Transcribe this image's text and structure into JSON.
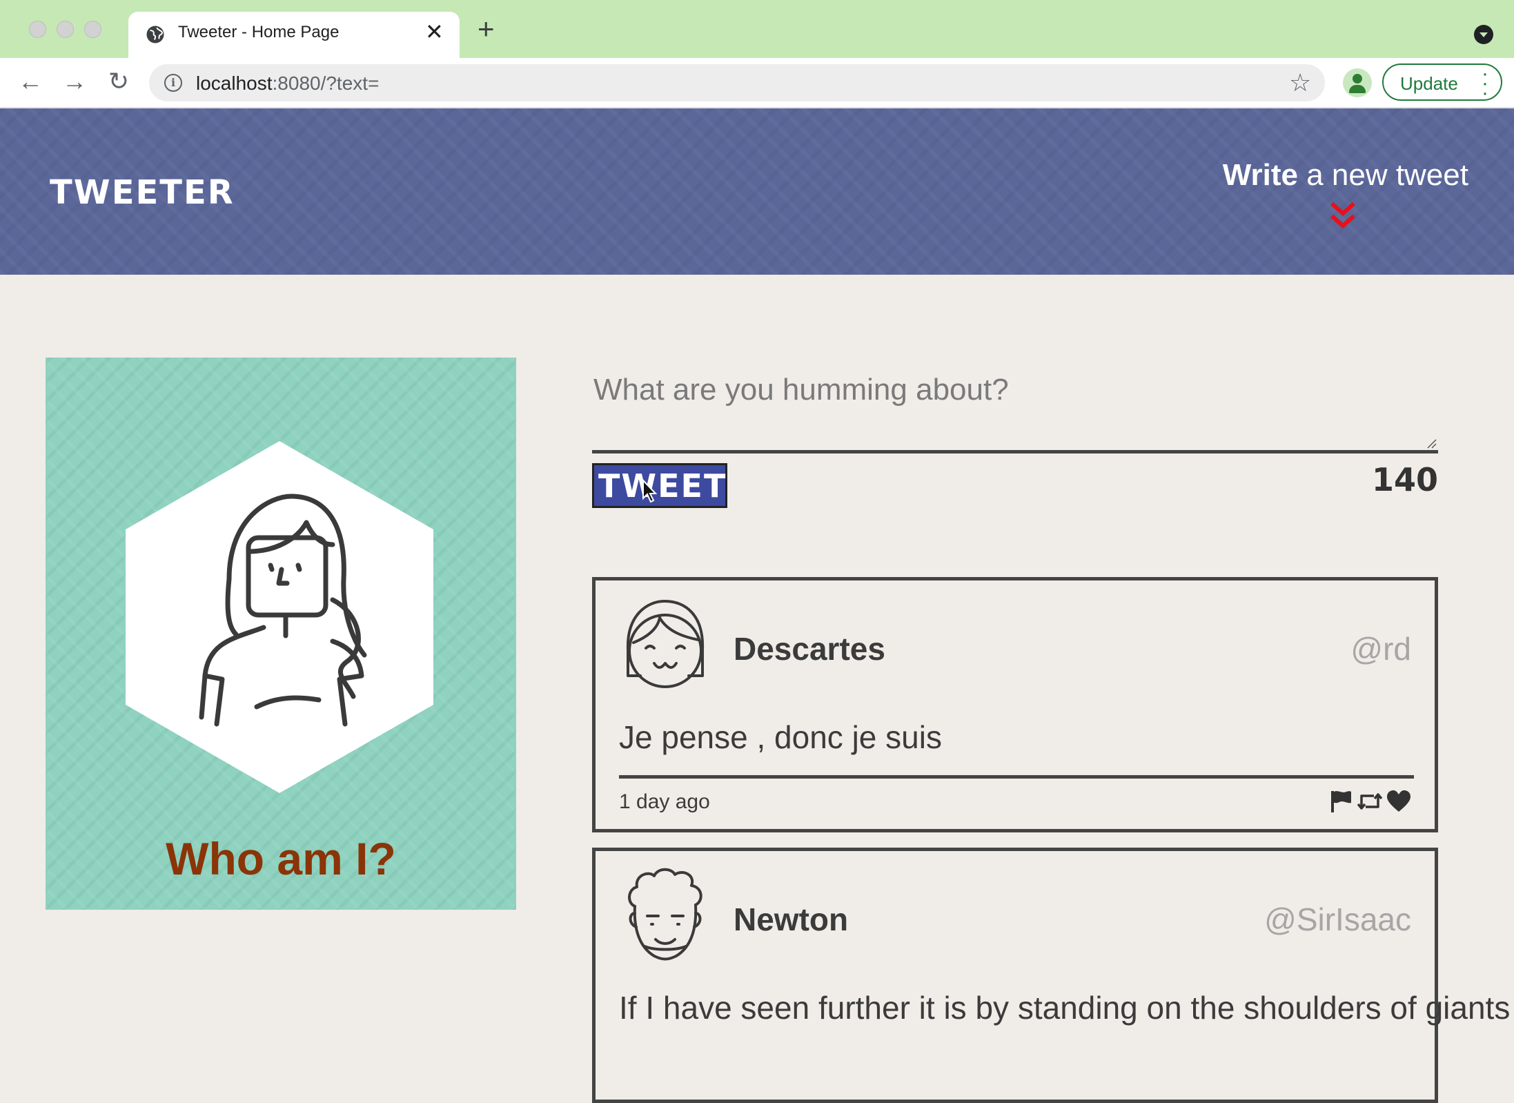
{
  "browser": {
    "tab_title": "Tweeter - Home Page",
    "url_host": "localhost",
    "url_rest": ":8080/?text=",
    "update_label": "Update"
  },
  "header": {
    "brand": "TWEETER",
    "compose_strong": "Write",
    "compose_rest": " a new tweet"
  },
  "profile": {
    "caption": "Who am I?"
  },
  "composer": {
    "placeholder": "What are you humming about?",
    "button_label": "TWEET",
    "char_count": "140"
  },
  "tweets": [
    {
      "name": "Descartes",
      "handle": "@rd",
      "text": "Je pense , donc je suis",
      "time": "1 day ago"
    },
    {
      "name": "Newton",
      "handle": "@SirIsaac",
      "text": "If I have seen further it is by standing on the shoulders of giants"
    }
  ],
  "icons": [
    "globe-icon",
    "close-icon",
    "plus-icon",
    "back-arrow-icon",
    "forward-arrow-icon",
    "reload-icon",
    "info-icon",
    "star-icon",
    "profile-icon",
    "more-vert-icon",
    "double-chevron-down-icon",
    "flag-icon",
    "retweet-icon",
    "heart-icon"
  ],
  "colors": {
    "header_bg": "#5b6799",
    "profile_bg": "#8ed2bf",
    "caption": "#8a3408",
    "tweet_button": "#3d4aa0",
    "chevron": "#e8101a",
    "page_bg": "#f0ede8"
  }
}
